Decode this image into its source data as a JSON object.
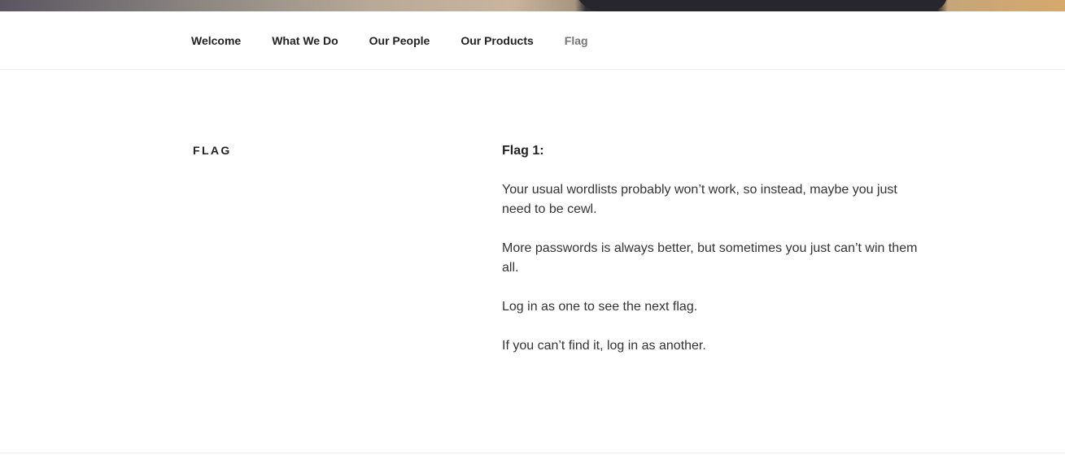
{
  "header": {
    "nav": [
      {
        "label": "Welcome",
        "current": false
      },
      {
        "label": "What We Do",
        "current": false
      },
      {
        "label": "Our People",
        "current": false
      },
      {
        "label": "Our Products",
        "current": false
      },
      {
        "label": "Flag",
        "current": true
      }
    ]
  },
  "page": {
    "title": "FLAG",
    "heading": "Flag 1:",
    "paragraphs": [
      "Your usual wordlists probably won’t work, so instead, maybe you just need to be cewl.",
      "More passwords is always better, but sometimes you just can’t win them all.",
      "Log in as one to see the next flag.",
      "If you can’t find it, log in as another."
    ]
  },
  "colors": {
    "text": "#333333",
    "nav_text": "#222222",
    "nav_current": "#767676",
    "divider": "#eeeeee"
  }
}
